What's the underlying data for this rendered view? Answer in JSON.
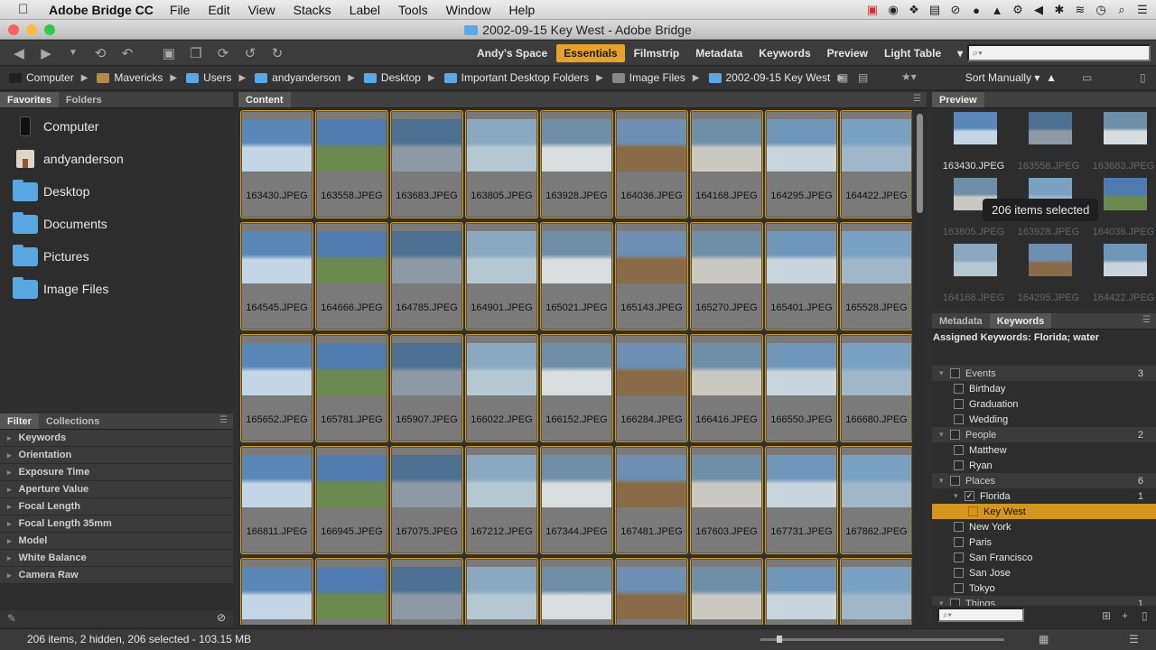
{
  "menubar": {
    "app": "Adobe Bridge CC",
    "items": [
      "File",
      "Edit",
      "View",
      "Stacks",
      "Label",
      "Tools",
      "Window",
      "Help"
    ]
  },
  "window": {
    "title": "2002-09-15 Key West - Adobe Bridge"
  },
  "workspaces": [
    {
      "label": "Andy's Space",
      "active": false
    },
    {
      "label": "Essentials",
      "active": true
    },
    {
      "label": "Filmstrip",
      "active": false
    },
    {
      "label": "Metadata",
      "active": false
    },
    {
      "label": "Keywords",
      "active": false
    },
    {
      "label": "Preview",
      "active": false
    },
    {
      "label": "Light Table",
      "active": false
    }
  ],
  "search": {
    "placeholder": "⌕▾"
  },
  "path": [
    {
      "label": "Computer",
      "icon": "computer-icon",
      "color": "#222222"
    },
    {
      "label": "Mavericks",
      "icon": "drive-icon",
      "color": "#b58a4a"
    },
    {
      "label": "Users",
      "icon": "folder-icon",
      "color": "#5aa8e6"
    },
    {
      "label": "andyanderson",
      "icon": "folder-icon",
      "color": "#5aa8e6"
    },
    {
      "label": "Desktop",
      "icon": "folder-icon",
      "color": "#5aa8e6"
    },
    {
      "label": "Important Desktop Folders",
      "icon": "folder-icon",
      "color": "#5aa8e6"
    },
    {
      "label": "Image Files",
      "icon": "image-icon",
      "color": "#888888"
    },
    {
      "label": "2002-09-15 Key West",
      "icon": "folder-icon",
      "color": "#5aa8e6"
    }
  ],
  "sort": "Sort Manually",
  "favorites": {
    "tabs": [
      "Favorites",
      "Folders"
    ],
    "items": [
      "Computer",
      "andyanderson",
      "Desktop",
      "Documents",
      "Pictures",
      "Image Files"
    ]
  },
  "filter": {
    "tabs": [
      "Filter",
      "Collections"
    ],
    "rows": [
      "Keywords",
      "Orientation",
      "Exposure Time",
      "Aperture Value",
      "Focal Length",
      "Focal Length 35mm",
      "Model",
      "White Balance",
      "Camera Raw"
    ]
  },
  "content": {
    "tab": "Content",
    "files": [
      "163430.JPEG",
      "163558.JPEG",
      "163683.JPEG",
      "163805.JPEG",
      "163928.JPEG",
      "164036.JPEG",
      "164168.JPEG",
      "164295.JPEG",
      "164422.JPEG",
      "164545.JPEG",
      "164666.JPEG",
      "164785.JPEG",
      "164901.JPEG",
      "165021.JPEG",
      "165143.JPEG",
      "165270.JPEG",
      "165401.JPEG",
      "165528.JPEG",
      "165652.JPEG",
      "165781.JPEG",
      "165907.JPEG",
      "166022.JPEG",
      "166152.JPEG",
      "166284.JPEG",
      "166416.JPEG",
      "166550.JPEG",
      "166680.JPEG",
      "166811.JPEG",
      "166945.JPEG",
      "167075.JPEG",
      "167212.JPEG",
      "167344.JPEG",
      "167481.JPEG",
      "167603.JPEG",
      "167731.JPEG",
      "167862.JPEG",
      "",
      "",
      "",
      "",
      "",
      "",
      "",
      "",
      ""
    ]
  },
  "preview": {
    "tab": "Preview",
    "badge": "206 items selected",
    "files": [
      "163430.JPEG",
      "163558.JPEG",
      "163683.JPEG",
      "163805.JPEG",
      "163928.JPEG",
      "164036.JPEG",
      "164168.JPEG",
      "164295.JPEG",
      "164422.JPEG"
    ]
  },
  "keywords": {
    "tabs": [
      "Metadata",
      "Keywords"
    ],
    "assigned": "Assigned Keywords: Florida; water",
    "rows": [
      {
        "label": "Events",
        "count": "3",
        "level": 0,
        "checked": false
      },
      {
        "label": "Birthday",
        "count": "",
        "level": 1,
        "checked": false
      },
      {
        "label": "Graduation",
        "count": "",
        "level": 1,
        "checked": false
      },
      {
        "label": "Wedding",
        "count": "",
        "level": 1,
        "checked": false
      },
      {
        "label": "People",
        "count": "2",
        "level": 0,
        "checked": false
      },
      {
        "label": "Matthew",
        "count": "",
        "level": 1,
        "checked": false
      },
      {
        "label": "Ryan",
        "count": "",
        "level": 1,
        "checked": false
      },
      {
        "label": "Places",
        "count": "6",
        "level": 0,
        "checked": false
      },
      {
        "label": "Florida",
        "count": "1",
        "level": 1,
        "checked": true
      },
      {
        "label": "Key West",
        "count": "",
        "level": 2,
        "checked": false,
        "highlight": true
      },
      {
        "label": "New York",
        "count": "",
        "level": 1,
        "checked": false
      },
      {
        "label": "Paris",
        "count": "",
        "level": 1,
        "checked": false
      },
      {
        "label": "San Francisco",
        "count": "",
        "level": 1,
        "checked": false
      },
      {
        "label": "San Jose",
        "count": "",
        "level": 1,
        "checked": false
      },
      {
        "label": "Tokyo",
        "count": "",
        "level": 1,
        "checked": false
      },
      {
        "label": "Things",
        "count": "1",
        "level": 0,
        "checked": false
      }
    ]
  },
  "status": "206 items, 2 hidden, 206 selected - 103.15 MB",
  "colors": {
    "accent": "#e8a12b",
    "selection": "#d4961f"
  }
}
